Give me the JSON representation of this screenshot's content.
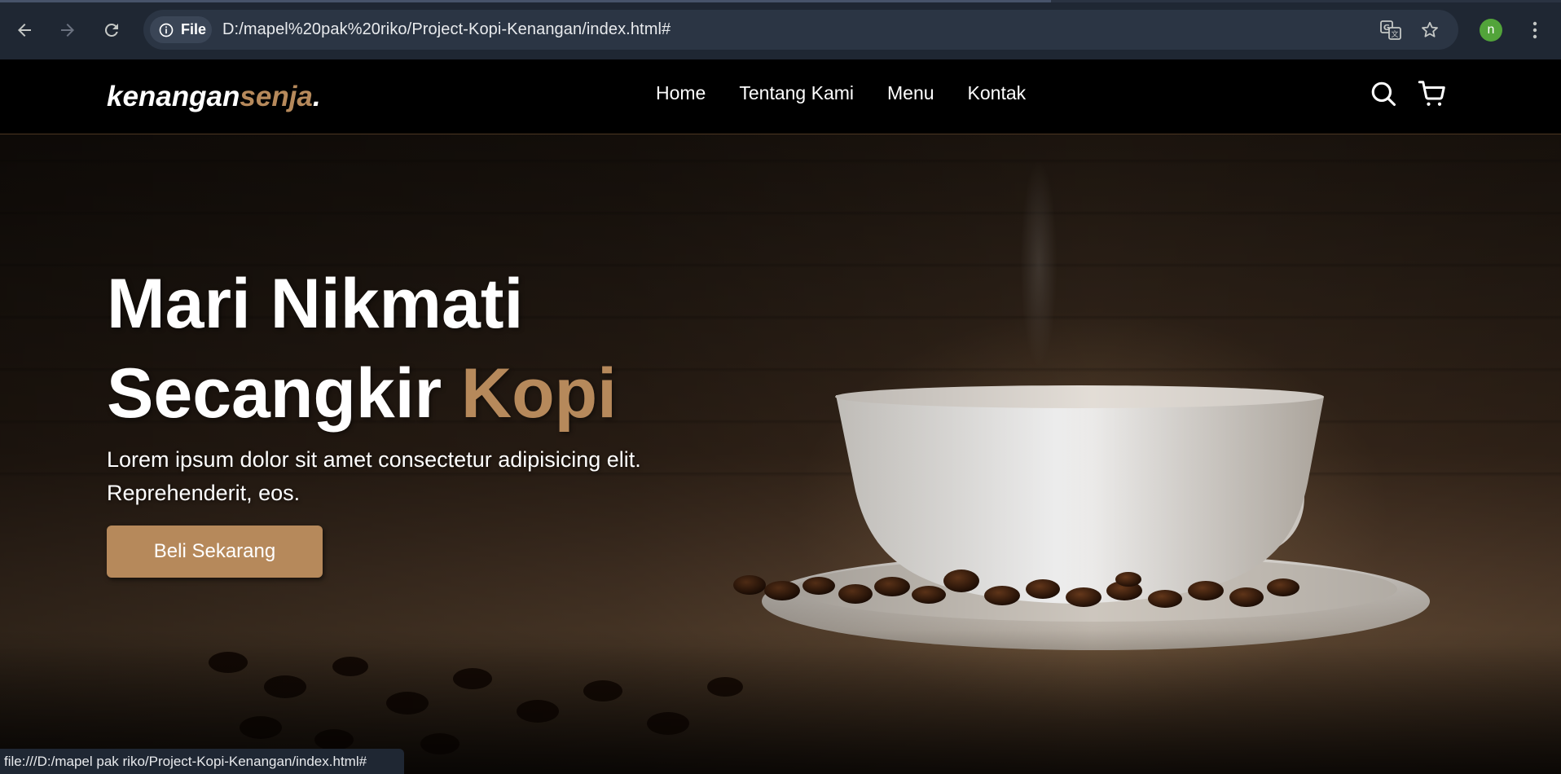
{
  "browser": {
    "back_icon": "arrow-left-icon",
    "forward_icon": "arrow-right-icon",
    "reload_icon": "reload-icon",
    "site_chip_label": "File",
    "url": "D:/mapel%20pak%20riko/Project-Kopi-Kenangan/index.html#",
    "profile_initial": "n",
    "status_url": "file:///D:/mapel pak riko/Project-Kopi-Kenangan/index.html#",
    "colors": {
      "chrome": "#1f2733",
      "omnibox": "#2b3544",
      "profile": "#52a43a"
    }
  },
  "site": {
    "logo_main": "kenangan",
    "logo_accent": "senja",
    "logo_dot": ".",
    "nav": [
      {
        "label": "Home"
      },
      {
        "label": "Tentang Kami"
      },
      {
        "label": "Menu"
      },
      {
        "label": "Kontak"
      }
    ],
    "icons": [
      "search-icon",
      "shopping-cart-icon"
    ],
    "accent_color": "#b6895b"
  },
  "hero": {
    "title_line1": "Mari Nikmati",
    "title_line2_main": "Secangkir ",
    "title_line2_accent": "Kopi",
    "description": "Lorem ipsum dolor sit amet consectetur adipisicing elit. Reprehenderit, eos.",
    "cta_label": "Beli Sekarang"
  }
}
